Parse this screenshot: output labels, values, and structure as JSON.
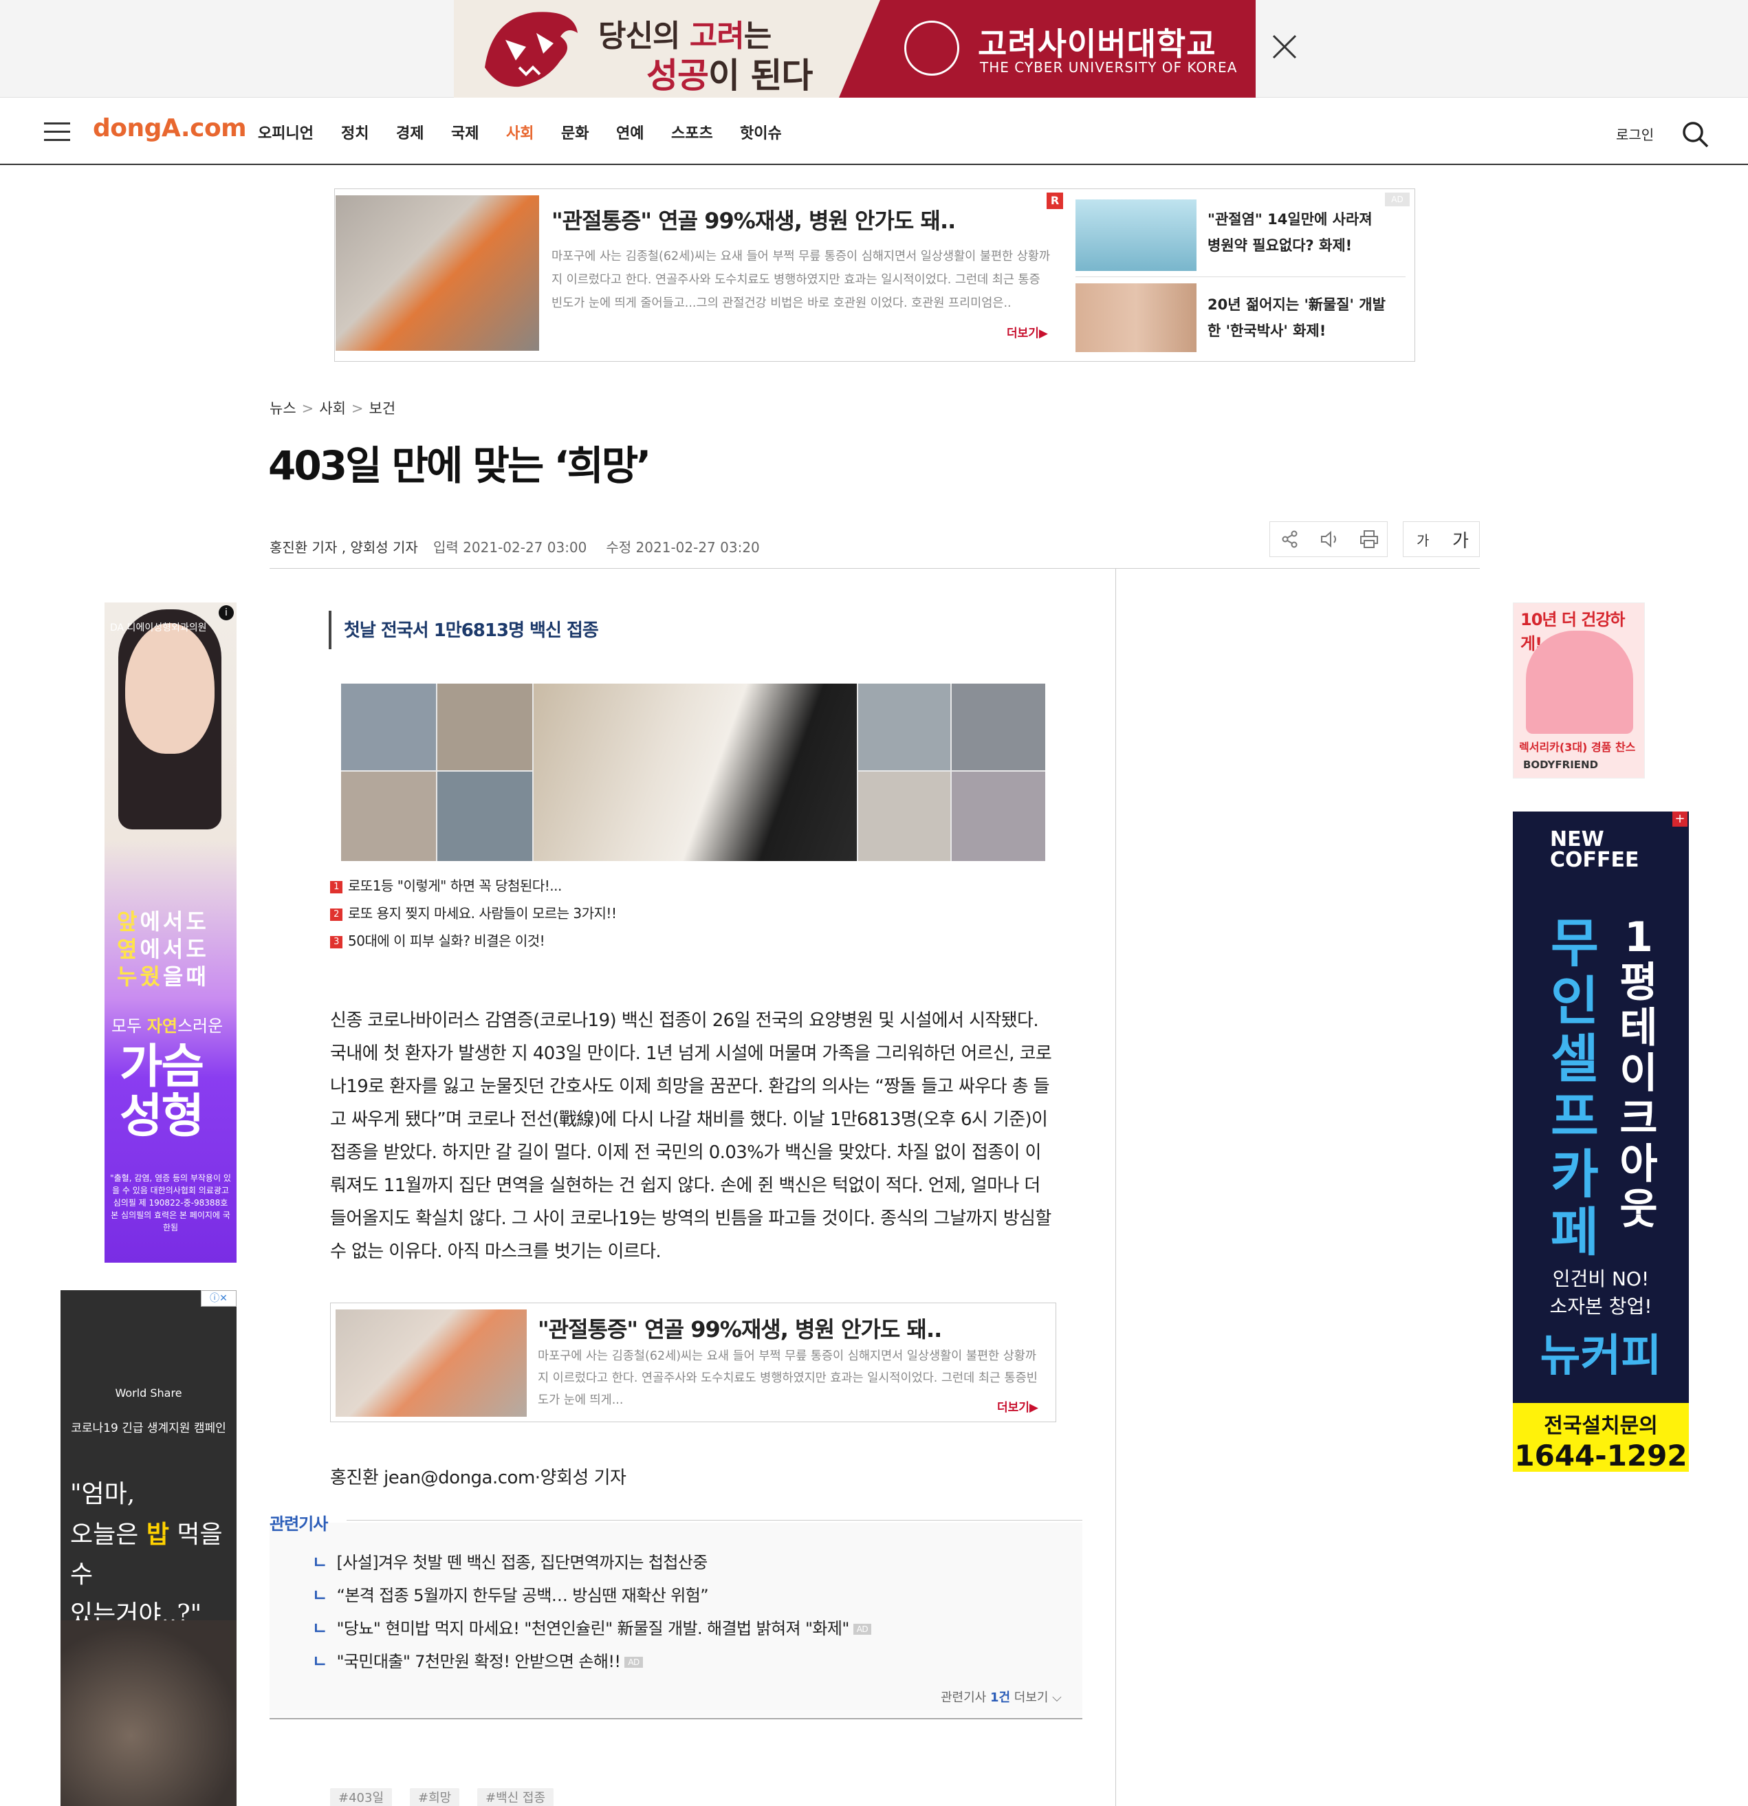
{
  "top_banner": {
    "slogan_line1_a": "당신의 ",
    "slogan_line1_b": "고려",
    "slogan_line1_c": "는",
    "slogan_line2_a": "성공",
    "slogan_line2_b": "이 된다",
    "university": "고려사이버대학교",
    "university_en": "THE CYBER UNIVERSITY OF KOREA"
  },
  "nav": {
    "logo": "dongA.com",
    "items": [
      "오피니언",
      "정치",
      "경제",
      "국제",
      "사회",
      "문화",
      "연예",
      "스포츠",
      "핫이슈"
    ],
    "active": "사회",
    "login": "로그인"
  },
  "ad_box": {
    "badge": "R",
    "title": "\"관절통증\" 연골 99%재생, 병원 안가도 돼..",
    "body": "마포구에 사는 김종철(62세)씨는 요새 들어 부쩍 무릎 통증이 심해지면서 일상생활이 불편한 상황까지 이르렀다고 한다. 연골주사와 도수치료도 병행하였지만 효과는 일시적이었다. 그런데 최근 통증빈도가 눈에 띄게 줄어들고...그의 관절건강 비법은 바로 호관원 이었다. 호관원 프리미엄은..",
    "more": "더보기▶",
    "ad_tag": "AD",
    "side1": "\"관절염\" 14일만에 사라져 병원약 필요없다? 화제!",
    "side2": "20년 젊어지는 '新물질' 개발한 '한국박사' 화제!"
  },
  "article": {
    "breadcrumb": [
      "뉴스",
      "사회",
      "보건"
    ],
    "headline": "403일 만에 맞는 ‘희망’",
    "byline": "홍진환 기자 , 양회성 기자",
    "input_date": "입력 2021-02-27 03:00",
    "modified_date": "수정 2021-02-27 03:20",
    "font_small": "가",
    "font_large": "가",
    "subhead": "첫날 전국서 1만6813명 백신 접종",
    "promos": [
      "로또1등 \"이렇게\" 하면 꼭 당첨된다!...",
      "로또 용지 찢지 마세요. 사람들이 모르는 3가지!!",
      "50대에 이 피부 실화? 비결은 이것!"
    ],
    "body": "신종 코로나바이러스 감염증(코로나19) 백신 접종이 26일 전국의 요양병원 및 시설에서 시작됐다. 국내에 첫 환자가 발생한 지 403일 만이다. 1년 넘게 시설에 머물며 가족을 그리워하던 어르신, 코로나19로 환자를 잃고 눈물짓던 간호사도 이제 희망을 꿈꾼다. 환갑의 의사는 “짱돌 들고 싸우다 총 들고 싸우게 됐다”며 코로나 전선(戰線)에 다시 나갈 채비를 했다. 이날 1만6813명(오후 6시 기준)이 접종을 받았다. 하지만 갈 길이 멀다. 이제 전 국민의 0.03%가 백신을 맞았다. 차질 없이 접종이 이뤄져도 11월까지 집단 면역을 실현하는 건 쉽지 않다. 손에 쥔 백신은 턱없이 적다. 언제, 얼마나 더 들어올지도 확실치 않다. 그 사이 코로나19는 방역의 빈틈을 파고들 것이다. 종식의 그날까지 방심할 수 없는 이유다. 아직 마스크를 벗기는 이르다.",
    "reporter_line": "홍진환 jean@donga.com·양회성 기자"
  },
  "inline_ad": {
    "title": "\"관절통증\" 연골 99%재생, 병원 안가도 돼..",
    "body": "마포구에 사는 김종철(62세)씨는 요새 들어 부쩍 무릎 통증이 심해지면서 일상생활이 불편한 상황까지 이르렀다고 한다. 연골주사와 도수치료도 병행하였지만 효과는 일시적이었다. 그런데 최근 통증빈도가 눈에 띄게...",
    "more": "더보기▶"
  },
  "related": {
    "label": "관련기사",
    "items": [
      {
        "text": "[사설]겨우 첫발 뗀 백신 접종, 집단면역까지는 첩첩산중",
        "ad": ""
      },
      {
        "text": "“본격 접종 5월까지 한두달 공백… 방심땐 재확산 위험”",
        "ad": ""
      },
      {
        "text": "\"당뇨\" 현미밥 먹지 마세요! \"천연인슐린\" 新물질 개발. 해결법 밝혀져 \"화제\"",
        "ad": "AD"
      },
      {
        "text": "\"국민대출\" 7천만원 확정! 안받으면 손해!!",
        "ad": "AD"
      }
    ],
    "more_prefix": "관련기사 ",
    "more_count": "1건",
    "more_suffix": " 더보기 ⌵"
  },
  "tags": [
    "#403일",
    "#희망",
    "#백신 접종"
  ],
  "left_ad1": {
    "brand": "DA 디에이성형외과의원",
    "line1a": "앞",
    "line1b": "에서도",
    "line2a": "옆",
    "line2b": "에서도",
    "line3a": "누웠",
    "line3b": "을때",
    "line4a": "모두 ",
    "line4b": "자연",
    "line4c": "스러운",
    "line5": "가슴",
    "line6": "성형",
    "disclaimer": "\"출혈, 감염, 염증 등의 부작용이 있을 수 있음 대한의사협회 의료광고심의필 제 190822-중-98388호 본 심의필의 효력은 본 페이지에 국한됨"
  },
  "left_ad2": {
    "brand": "World Share",
    "campaign": "코로나19 긴급 생계지원 캠페인",
    "quote_a": "\"엄마,",
    "quote_b1": "오늘은 ",
    "quote_b2": "밥",
    "quote_b3": " 먹을 수",
    "quote_c": "있는거야..?\""
  },
  "right_ad1": {
    "title": "10년 더 건강하게!",
    "sub": "렉서리카(3대) 경품 찬스",
    "brand": "BODYFRIEND"
  },
  "right_ad2": {
    "logo_line1": "NEW",
    "logo_line2": "COFFEE",
    "vertical1": [
      "무",
      "인",
      "셀",
      "프",
      "카",
      "페"
    ],
    "vertical2": [
      "1",
      "평",
      "테",
      "이",
      "크",
      "아",
      "웃"
    ],
    "line1": "인건비 NO!",
    "line2": "소자본 창업!",
    "brand": "뉴커피",
    "cta": "전국설치문의",
    "phone": "1644-1292"
  },
  "colors": {
    "accent": "#e8672f",
    "link_blue": "#2a5cb8",
    "ad_red": "#c8102e"
  }
}
